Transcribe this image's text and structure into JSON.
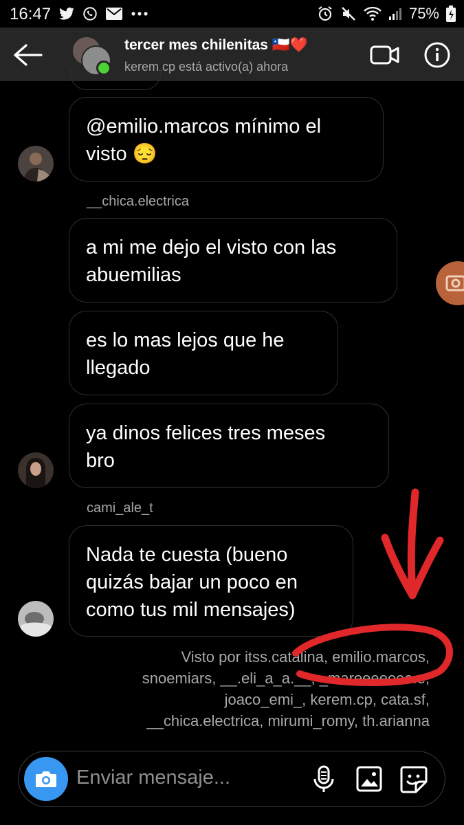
{
  "status_bar": {
    "time": "16:47",
    "battery": "75%"
  },
  "header": {
    "title": "tercer mes chilenitas 🇨🇱❤️",
    "subtitle": "kerem.cp está activo(a) ahora"
  },
  "messages": [
    {
      "text_lines": [
        "@emilio.marcos mínimo el",
        "visto 😔"
      ]
    },
    {
      "sender": "__chica.electrica",
      "text_lines": [
        "a mi me dejo el visto con las",
        "abuemilias"
      ]
    },
    {
      "text_lines": [
        "es lo mas lejos que he",
        "llegado"
      ]
    },
    {
      "text_lines": [
        "ya dinos felices tres meses",
        "bro"
      ]
    },
    {
      "sender": "cami_ale_t",
      "text_lines": [
        "Nada te cuesta (bueno",
        "quizás bajar un poco en",
        "como tus mil mensajes)"
      ]
    }
  ],
  "seen_by": {
    "lines": [
      "Visto por itss.catalina, emilio.marcos,",
      "snoemiars, __.eli_a_a.__, _mareeeeeee.e,",
      "joaco_emi_, kerem.cp, cata.sf,",
      "__chica.electrica, mirumi_romy, th.arianna"
    ]
  },
  "composer": {
    "placeholder": "Enviar mensaje..."
  },
  "colors": {
    "header_bg": "#262626",
    "accent_blue": "#3897f0",
    "online_green": "#4cd137",
    "annotation_red": "#e0282b"
  }
}
